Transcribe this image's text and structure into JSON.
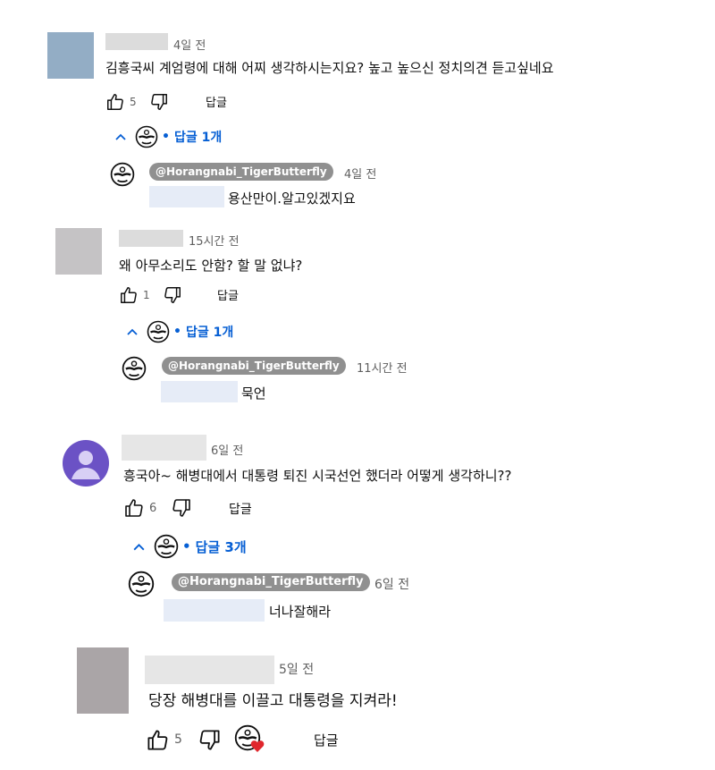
{
  "colors": {
    "link_blue": "#065fd4",
    "chip_bg": "#909090",
    "heart_red": "#e0262c",
    "avatar_purple": "#6b52c5"
  },
  "comments": [
    {
      "time": "4일 전",
      "text": "김흥국씨 계엄령에 대해 어찌 생각하시는지요? 높고 높으신 정치의견 듣고싶네요",
      "likes": "5",
      "reply_label": "답글",
      "toggle": "답글 1개",
      "reply": {
        "handle": "@Horangnabi_TigerButterfly",
        "time": "4일 전",
        "text": "용산만이.알고있겠지요"
      }
    },
    {
      "time": "15시간 전",
      "text": "왜 아무소리도 안함?  할 말 없냐?",
      "likes": "1",
      "reply_label": "답글",
      "toggle": "답글 1개",
      "reply": {
        "handle": "@Horangnabi_TigerButterfly",
        "time": "11시간 전",
        "text": "묵언"
      }
    },
    {
      "time": "6일 전",
      "text": "흥국아~ 해병대에서 대통령 퇴진 시국선언 했더라 어떻게 생각하니??",
      "likes": "6",
      "reply_label": "답글",
      "toggle": "답글 3개",
      "reply": {
        "handle": "@Horangnabi_TigerButterfly",
        "time": "6일 전",
        "text": "너나잘해라"
      }
    },
    {
      "time": "5일 전",
      "text": "당장 해병대를 이끌고 대통령을 지켜라!",
      "likes": "5",
      "reply_label": "답글"
    }
  ]
}
